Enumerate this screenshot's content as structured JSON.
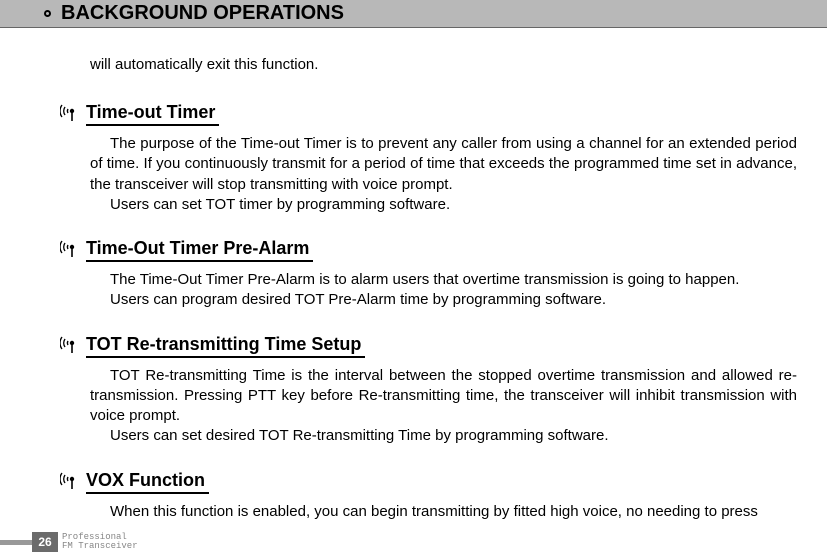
{
  "header": {
    "title": "BACKGROUND OPERATIONS"
  },
  "intro": "will automatically exit this function.",
  "sections": [
    {
      "title": "Time-out Timer",
      "paragraphs": [
        "The purpose of the Time-out Timer is to prevent any caller from using a channel for an extended period of time. If you continuously transmit for a period of time that exceeds the programmed time set in advance, the transceiver will stop transmitting with voice prompt.",
        "Users can set TOT timer by programming software."
      ]
    },
    {
      "title": "Time-Out Timer Pre-Alarm",
      "paragraphs": [
        "The Time-Out Timer Pre-Alarm is to alarm users that overtime transmission is going to happen.",
        "Users can program desired TOT Pre-Alarm time by programming software."
      ]
    },
    {
      "title": "TOT Re-transmitting Time Setup",
      "paragraphs": [
        "TOT Re-transmitting Time is the interval between the stopped overtime transmission and allowed re-transmission. Pressing PTT key before Re-transmitting time, the transceiver will inhibit transmission with voice prompt.",
        "Users can set desired TOT Re-transmitting Time by programming software."
      ]
    },
    {
      "title": "VOX Function",
      "paragraphs": [
        "When this function is enabled, you can begin transmitting by fitted high voice, no needing to press"
      ]
    }
  ],
  "footer": {
    "page": "26",
    "line1": "Professional",
    "line2": "FM Transceiver"
  }
}
